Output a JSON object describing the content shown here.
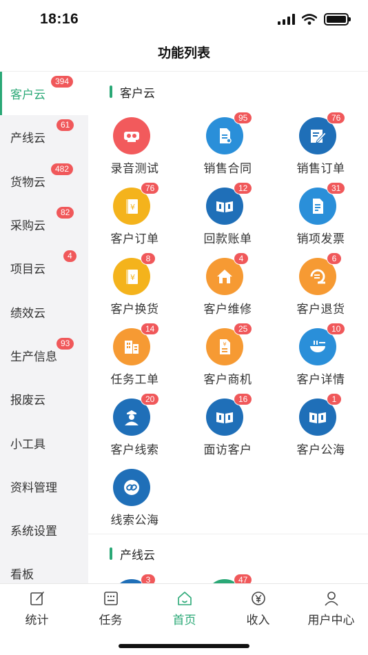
{
  "status_bar": {
    "time": "18:16"
  },
  "nav": {
    "title": "功能列表"
  },
  "sidebar": {
    "items": [
      {
        "label": "客户云",
        "badge": "394",
        "active": true
      },
      {
        "label": "产线云",
        "badge": "61"
      },
      {
        "label": "货物云",
        "badge": "482"
      },
      {
        "label": "采购云",
        "badge": "82"
      },
      {
        "label": "项目云",
        "badge": "4"
      },
      {
        "label": "绩效云",
        "badge": ""
      },
      {
        "label": "生产信息",
        "badge": "93"
      },
      {
        "label": "报废云",
        "badge": ""
      },
      {
        "label": "小工具",
        "badge": ""
      },
      {
        "label": "资料管理",
        "badge": ""
      },
      {
        "label": "系统设置",
        "badge": ""
      },
      {
        "label": "看板",
        "badge": ""
      }
    ]
  },
  "sections": [
    {
      "title": "客户云",
      "items": [
        {
          "label": "录音测试",
          "badge": "",
          "icon": "recorder-icon",
          "color": "#f25a5c"
        },
        {
          "label": "销售合同",
          "badge": "95",
          "icon": "contract-icon",
          "color": "#2a8fd9"
        },
        {
          "label": "销售订单",
          "badge": "76",
          "icon": "order-edit-icon",
          "color": "#1f6fb8"
        },
        {
          "label": "客户订单",
          "badge": "76",
          "icon": "ledger-yen-icon",
          "color": "#f4b31c"
        },
        {
          "label": "回款账单",
          "badge": "12",
          "icon": "open-book-icon",
          "color": "#1f6fb8"
        },
        {
          "label": "销项发票",
          "badge": "31",
          "icon": "invoice-icon",
          "color": "#2a8fd9"
        },
        {
          "label": "客户换货",
          "badge": "8",
          "icon": "ledger-yen-icon",
          "color": "#f4b31c"
        },
        {
          "label": "客户维修",
          "badge": "4",
          "icon": "house-icon",
          "color": "#f69a33"
        },
        {
          "label": "客户退货",
          "badge": "6",
          "icon": "return-coin-icon",
          "color": "#f69a33"
        },
        {
          "label": "任务工单",
          "badge": "14",
          "icon": "building-icon",
          "color": "#f69a33"
        },
        {
          "label": "客户商机",
          "badge": "25",
          "icon": "opportunity-doc-icon",
          "color": "#f69a33"
        },
        {
          "label": "客户详情",
          "badge": "10",
          "icon": "detail-bowl-icon",
          "color": "#2a8fd9"
        },
        {
          "label": "客户线索",
          "badge": "20",
          "icon": "officer-icon",
          "color": "#1f6fb8"
        },
        {
          "label": "面访客户",
          "badge": "16",
          "icon": "open-book-icon",
          "color": "#1f6fb8"
        },
        {
          "label": "客户公海",
          "badge": "1",
          "icon": "open-book-icon",
          "color": "#1f6fb8"
        },
        {
          "label": "线索公海",
          "badge": "",
          "icon": "link-icon",
          "color": "#1f6fb8"
        }
      ]
    },
    {
      "title": "产线云",
      "items": [
        {
          "badge": "3",
          "color": "#1f6fb8"
        },
        {
          "badge": "47",
          "color": "#2aa876"
        }
      ]
    }
  ],
  "tabbar": {
    "items": [
      {
        "label": "统计",
        "icon": "edit-square-icon"
      },
      {
        "label": "任务",
        "icon": "task-list-icon"
      },
      {
        "label": "首页",
        "icon": "home-icon",
        "active": true
      },
      {
        "label": "收入",
        "icon": "income-yen-icon"
      },
      {
        "label": "用户中心",
        "icon": "user-icon"
      }
    ]
  }
}
